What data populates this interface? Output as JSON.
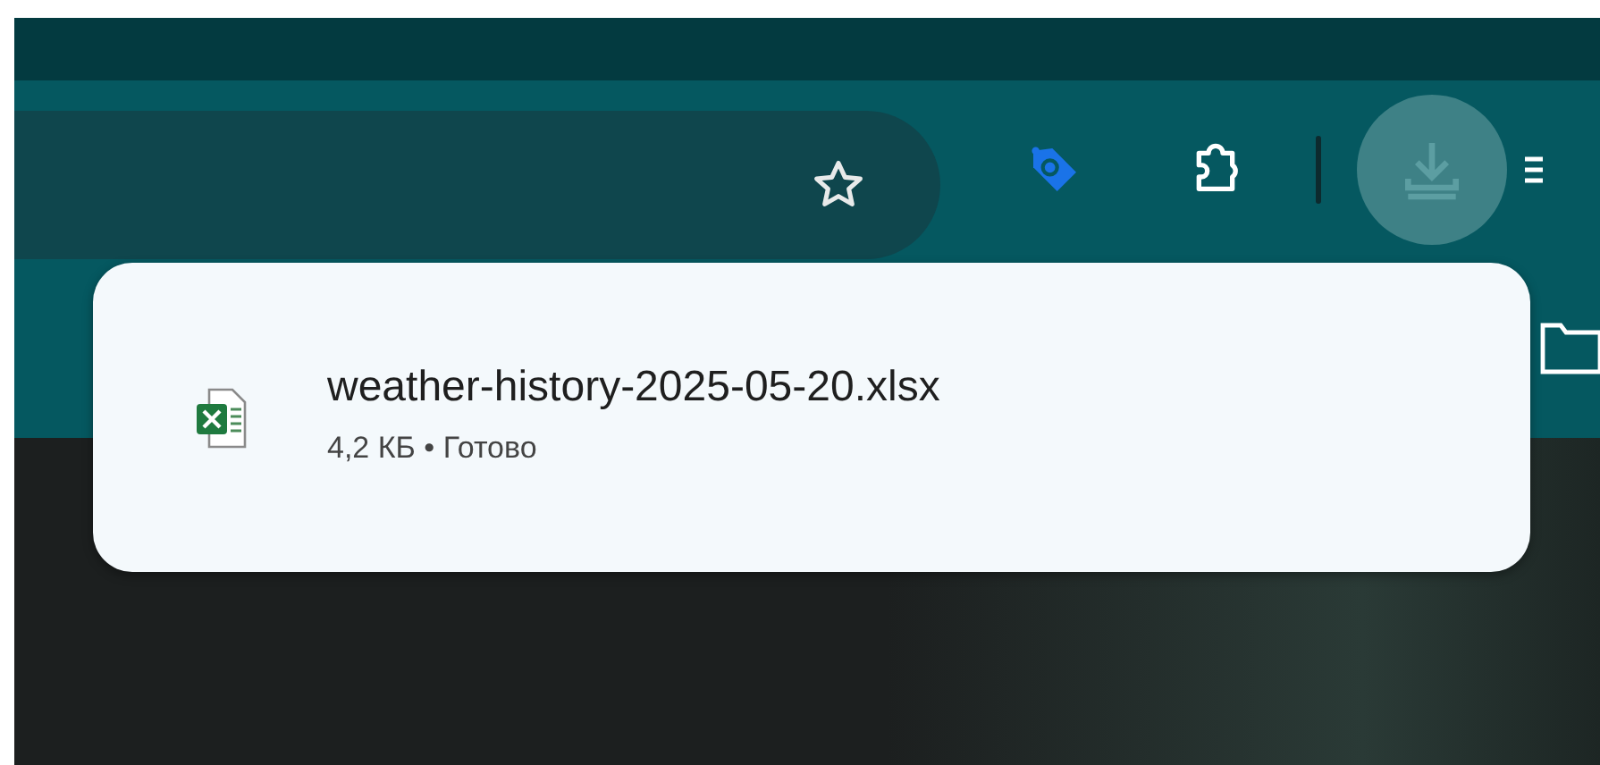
{
  "download": {
    "file_name": "weather-history-2025-05-20.xlsx",
    "status": "4,2 КБ • Готово"
  }
}
